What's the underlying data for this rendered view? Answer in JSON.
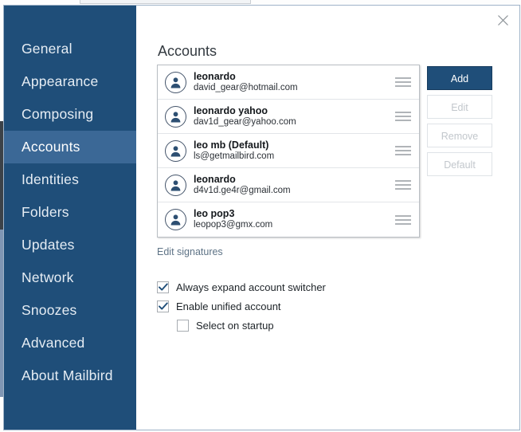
{
  "window": {
    "close_icon": "close-icon"
  },
  "sidebar": {
    "items": [
      {
        "label": "General",
        "selected": false
      },
      {
        "label": "Appearance",
        "selected": false
      },
      {
        "label": "Composing",
        "selected": false
      },
      {
        "label": "Accounts",
        "selected": true
      },
      {
        "label": "Identities",
        "selected": false
      },
      {
        "label": "Folders",
        "selected": false
      },
      {
        "label": "Updates",
        "selected": false
      },
      {
        "label": "Network",
        "selected": false
      },
      {
        "label": "Snoozes",
        "selected": false
      },
      {
        "label": "Advanced",
        "selected": false
      },
      {
        "label": "About Mailbird",
        "selected": false
      }
    ]
  },
  "main": {
    "title": "Accounts",
    "accounts": [
      {
        "name": "leonardo",
        "email": "david_gear@hotmail.com",
        "avatar_icon": "user-avatar-icon",
        "handle_icon": "drag-handle-icon"
      },
      {
        "name": "leonardo yahoo",
        "email": "dav1d_gear@yahoo.com",
        "avatar_icon": "user-avatar-icon",
        "handle_icon": "drag-handle-icon"
      },
      {
        "name": "leo mb (Default)",
        "email": "ls@getmailbird.com",
        "avatar_icon": "user-avatar-icon",
        "handle_icon": "drag-handle-icon"
      },
      {
        "name": "leonardo",
        "email": "d4v1d.ge4r@gmail.com",
        "avatar_icon": "user-avatar-icon",
        "handle_icon": "drag-handle-icon"
      },
      {
        "name": "leo pop3",
        "email": "leopop3@gmx.com",
        "avatar_icon": "user-avatar-icon",
        "handle_icon": "drag-handle-icon"
      }
    ],
    "buttons": [
      {
        "label": "Add",
        "state": "enabled"
      },
      {
        "label": "Edit",
        "state": "disabled"
      },
      {
        "label": "Remove",
        "state": "disabled"
      },
      {
        "label": "Default",
        "state": "disabled"
      }
    ],
    "edit_signatures_link": "Edit signatures",
    "checkboxes": [
      {
        "label": "Always expand account switcher",
        "checked": true,
        "indent": false
      },
      {
        "label": "Enable unified account",
        "checked": true,
        "indent": false
      },
      {
        "label": "Select on startup",
        "checked": false,
        "indent": true
      }
    ]
  },
  "colors": {
    "sidebar_blue": "#1f4e79",
    "sidebar_selected": "#3b6896",
    "primary_button": "#1f4e79",
    "disabled_text": "#c2c7cc",
    "link_gray": "#5e7386"
  }
}
